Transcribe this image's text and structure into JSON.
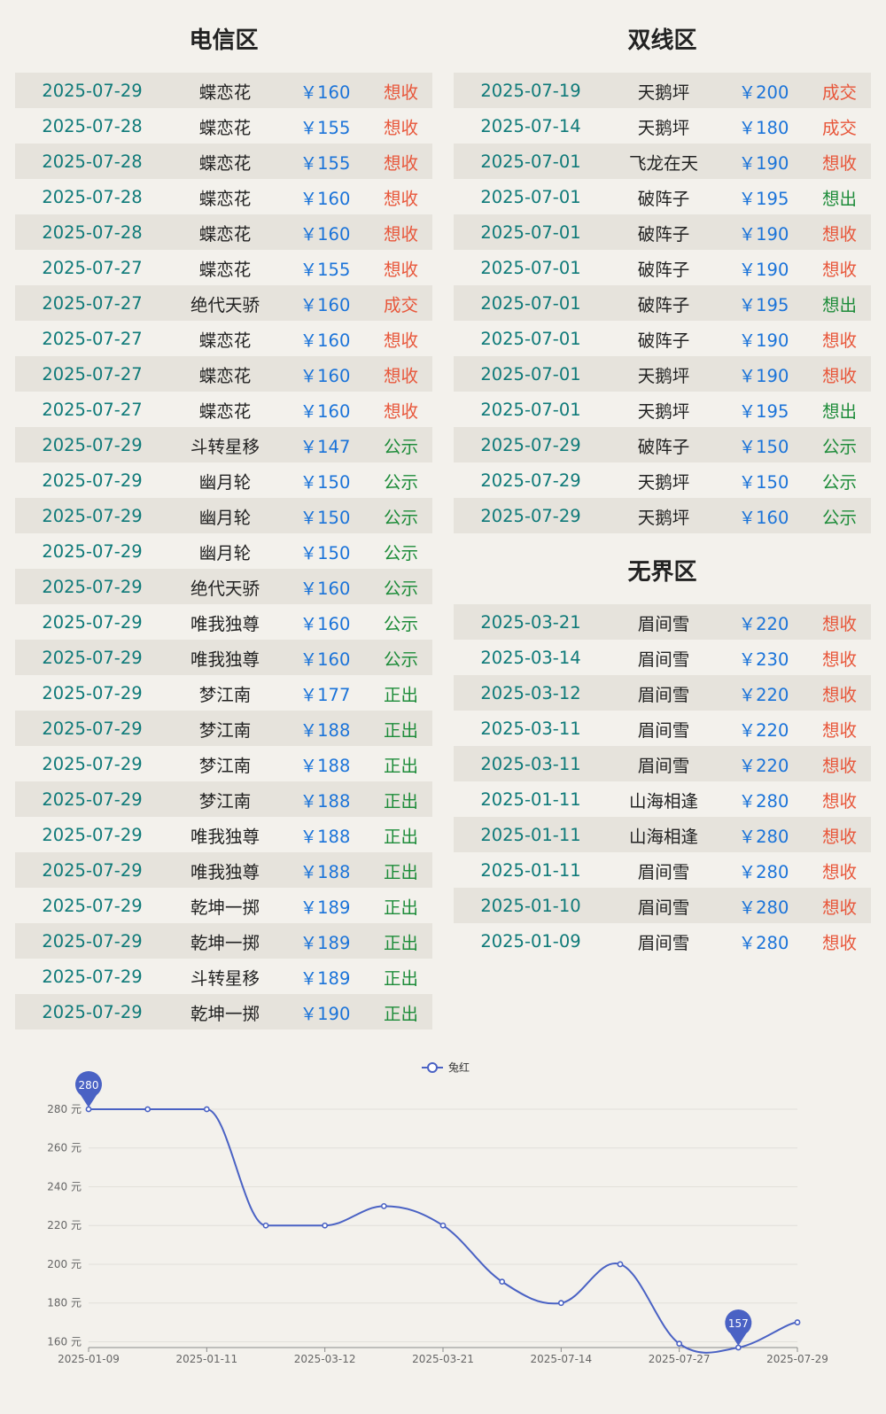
{
  "telecom": {
    "title": "电信区",
    "rows": [
      {
        "date": "2025-07-29",
        "name": "蝶恋花",
        "price": "￥160",
        "status": "想收",
        "tone": "red"
      },
      {
        "date": "2025-07-28",
        "name": "蝶恋花",
        "price": "￥155",
        "status": "想收",
        "tone": "red"
      },
      {
        "date": "2025-07-28",
        "name": "蝶恋花",
        "price": "￥155",
        "status": "想收",
        "tone": "red"
      },
      {
        "date": "2025-07-28",
        "name": "蝶恋花",
        "price": "￥160",
        "status": "想收",
        "tone": "red"
      },
      {
        "date": "2025-07-28",
        "name": "蝶恋花",
        "price": "￥160",
        "status": "想收",
        "tone": "red"
      },
      {
        "date": "2025-07-27",
        "name": "蝶恋花",
        "price": "￥155",
        "status": "想收",
        "tone": "red"
      },
      {
        "date": "2025-07-27",
        "name": "绝代天骄",
        "price": "￥160",
        "status": "成交",
        "tone": "red"
      },
      {
        "date": "2025-07-27",
        "name": "蝶恋花",
        "price": "￥160",
        "status": "想收",
        "tone": "red"
      },
      {
        "date": "2025-07-27",
        "name": "蝶恋花",
        "price": "￥160",
        "status": "想收",
        "tone": "red"
      },
      {
        "date": "2025-07-27",
        "name": "蝶恋花",
        "price": "￥160",
        "status": "想收",
        "tone": "red"
      },
      {
        "date": "2025-07-29",
        "name": "斗转星移",
        "price": "￥147",
        "status": "公示",
        "tone": "green"
      },
      {
        "date": "2025-07-29",
        "name": "幽月轮",
        "price": "￥150",
        "status": "公示",
        "tone": "green"
      },
      {
        "date": "2025-07-29",
        "name": "幽月轮",
        "price": "￥150",
        "status": "公示",
        "tone": "green"
      },
      {
        "date": "2025-07-29",
        "name": "幽月轮",
        "price": "￥150",
        "status": "公示",
        "tone": "green"
      },
      {
        "date": "2025-07-29",
        "name": "绝代天骄",
        "price": "￥160",
        "status": "公示",
        "tone": "green"
      },
      {
        "date": "2025-07-29",
        "name": "唯我独尊",
        "price": "￥160",
        "status": "公示",
        "tone": "green"
      },
      {
        "date": "2025-07-29",
        "name": "唯我独尊",
        "price": "￥160",
        "status": "公示",
        "tone": "green"
      },
      {
        "date": "2025-07-29",
        "name": "梦江南",
        "price": "￥177",
        "status": "正出",
        "tone": "green"
      },
      {
        "date": "2025-07-29",
        "name": "梦江南",
        "price": "￥188",
        "status": "正出",
        "tone": "green"
      },
      {
        "date": "2025-07-29",
        "name": "梦江南",
        "price": "￥188",
        "status": "正出",
        "tone": "green"
      },
      {
        "date": "2025-07-29",
        "name": "梦江南",
        "price": "￥188",
        "status": "正出",
        "tone": "green"
      },
      {
        "date": "2025-07-29",
        "name": "唯我独尊",
        "price": "￥188",
        "status": "正出",
        "tone": "green"
      },
      {
        "date": "2025-07-29",
        "name": "唯我独尊",
        "price": "￥188",
        "status": "正出",
        "tone": "green"
      },
      {
        "date": "2025-07-29",
        "name": "乾坤一掷",
        "price": "￥189",
        "status": "正出",
        "tone": "green"
      },
      {
        "date": "2025-07-29",
        "name": "乾坤一掷",
        "price": "￥189",
        "status": "正出",
        "tone": "green"
      },
      {
        "date": "2025-07-29",
        "name": "斗转星移",
        "price": "￥189",
        "status": "正出",
        "tone": "green"
      },
      {
        "date": "2025-07-29",
        "name": "乾坤一掷",
        "price": "￥190",
        "status": "正出",
        "tone": "green"
      }
    ]
  },
  "dual": {
    "title": "双线区",
    "rows": [
      {
        "date": "2025-07-19",
        "name": "天鹅坪",
        "price": "￥200",
        "status": "成交",
        "tone": "red"
      },
      {
        "date": "2025-07-14",
        "name": "天鹅坪",
        "price": "￥180",
        "status": "成交",
        "tone": "red"
      },
      {
        "date": "2025-07-01",
        "name": "飞龙在天",
        "price": "￥190",
        "status": "想收",
        "tone": "red"
      },
      {
        "date": "2025-07-01",
        "name": "破阵子",
        "price": "￥195",
        "status": "想出",
        "tone": "green"
      },
      {
        "date": "2025-07-01",
        "name": "破阵子",
        "price": "￥190",
        "status": "想收",
        "tone": "red"
      },
      {
        "date": "2025-07-01",
        "name": "破阵子",
        "price": "￥190",
        "status": "想收",
        "tone": "red"
      },
      {
        "date": "2025-07-01",
        "name": "破阵子",
        "price": "￥195",
        "status": "想出",
        "tone": "green"
      },
      {
        "date": "2025-07-01",
        "name": "破阵子",
        "price": "￥190",
        "status": "想收",
        "tone": "red"
      },
      {
        "date": "2025-07-01",
        "name": "天鹅坪",
        "price": "￥190",
        "status": "想收",
        "tone": "red"
      },
      {
        "date": "2025-07-01",
        "name": "天鹅坪",
        "price": "￥195",
        "status": "想出",
        "tone": "green"
      },
      {
        "date": "2025-07-29",
        "name": "破阵子",
        "price": "￥150",
        "status": "公示",
        "tone": "green"
      },
      {
        "date": "2025-07-29",
        "name": "天鹅坪",
        "price": "￥150",
        "status": "公示",
        "tone": "green"
      },
      {
        "date": "2025-07-29",
        "name": "天鹅坪",
        "price": "￥160",
        "status": "公示",
        "tone": "green"
      }
    ]
  },
  "boundless": {
    "title": "无界区",
    "rows": [
      {
        "date": "2025-03-21",
        "name": "眉间雪",
        "price": "￥220",
        "status": "想收",
        "tone": "red"
      },
      {
        "date": "2025-03-14",
        "name": "眉间雪",
        "price": "￥230",
        "status": "想收",
        "tone": "red"
      },
      {
        "date": "2025-03-12",
        "name": "眉间雪",
        "price": "￥220",
        "status": "想收",
        "tone": "red"
      },
      {
        "date": "2025-03-11",
        "name": "眉间雪",
        "price": "￥220",
        "status": "想收",
        "tone": "red"
      },
      {
        "date": "2025-03-11",
        "name": "眉间雪",
        "price": "￥220",
        "status": "想收",
        "tone": "red"
      },
      {
        "date": "2025-01-11",
        "name": "山海相逢",
        "price": "￥280",
        "status": "想收",
        "tone": "red"
      },
      {
        "date": "2025-01-11",
        "name": "山海相逢",
        "price": "￥280",
        "status": "想收",
        "tone": "red"
      },
      {
        "date": "2025-01-11",
        "name": "眉间雪",
        "price": "￥280",
        "status": "想收",
        "tone": "red"
      },
      {
        "date": "2025-01-10",
        "name": "眉间雪",
        "price": "￥280",
        "status": "想收",
        "tone": "red"
      },
      {
        "date": "2025-01-09",
        "name": "眉间雪",
        "price": "￥280",
        "status": "想收",
        "tone": "red"
      }
    ]
  },
  "colors": {
    "date": "#0f7a79",
    "price": "#1a73d9",
    "status_red": "#e8563a",
    "status_green": "#1e8c3a",
    "series": "#4a62c4"
  },
  "chart_data": {
    "type": "line",
    "smooth": true,
    "legend_position": "top-center",
    "series": [
      {
        "name": "兔红",
        "values": [
          280,
          280,
          280,
          220,
          220,
          230,
          220,
          191,
          180,
          200,
          159,
          157,
          170
        ]
      }
    ],
    "x_tick_labels": [
      "2025-01-09",
      "2025-01-11",
      "2025-03-12",
      "2025-03-21",
      "2025-07-14",
      "2025-07-27",
      "2025-07-29"
    ],
    "y_ticks": [
      "160 元",
      "180 元",
      "200 元",
      "220 元",
      "240 元",
      "260 元",
      "280 元"
    ],
    "y_unit": "元",
    "ylim": [
      157,
      280
    ],
    "grid": true,
    "markers": {
      "max": {
        "label": "280",
        "value": 280,
        "index": 0
      },
      "min": {
        "label": "157",
        "value": 157,
        "index": 11
      }
    }
  }
}
